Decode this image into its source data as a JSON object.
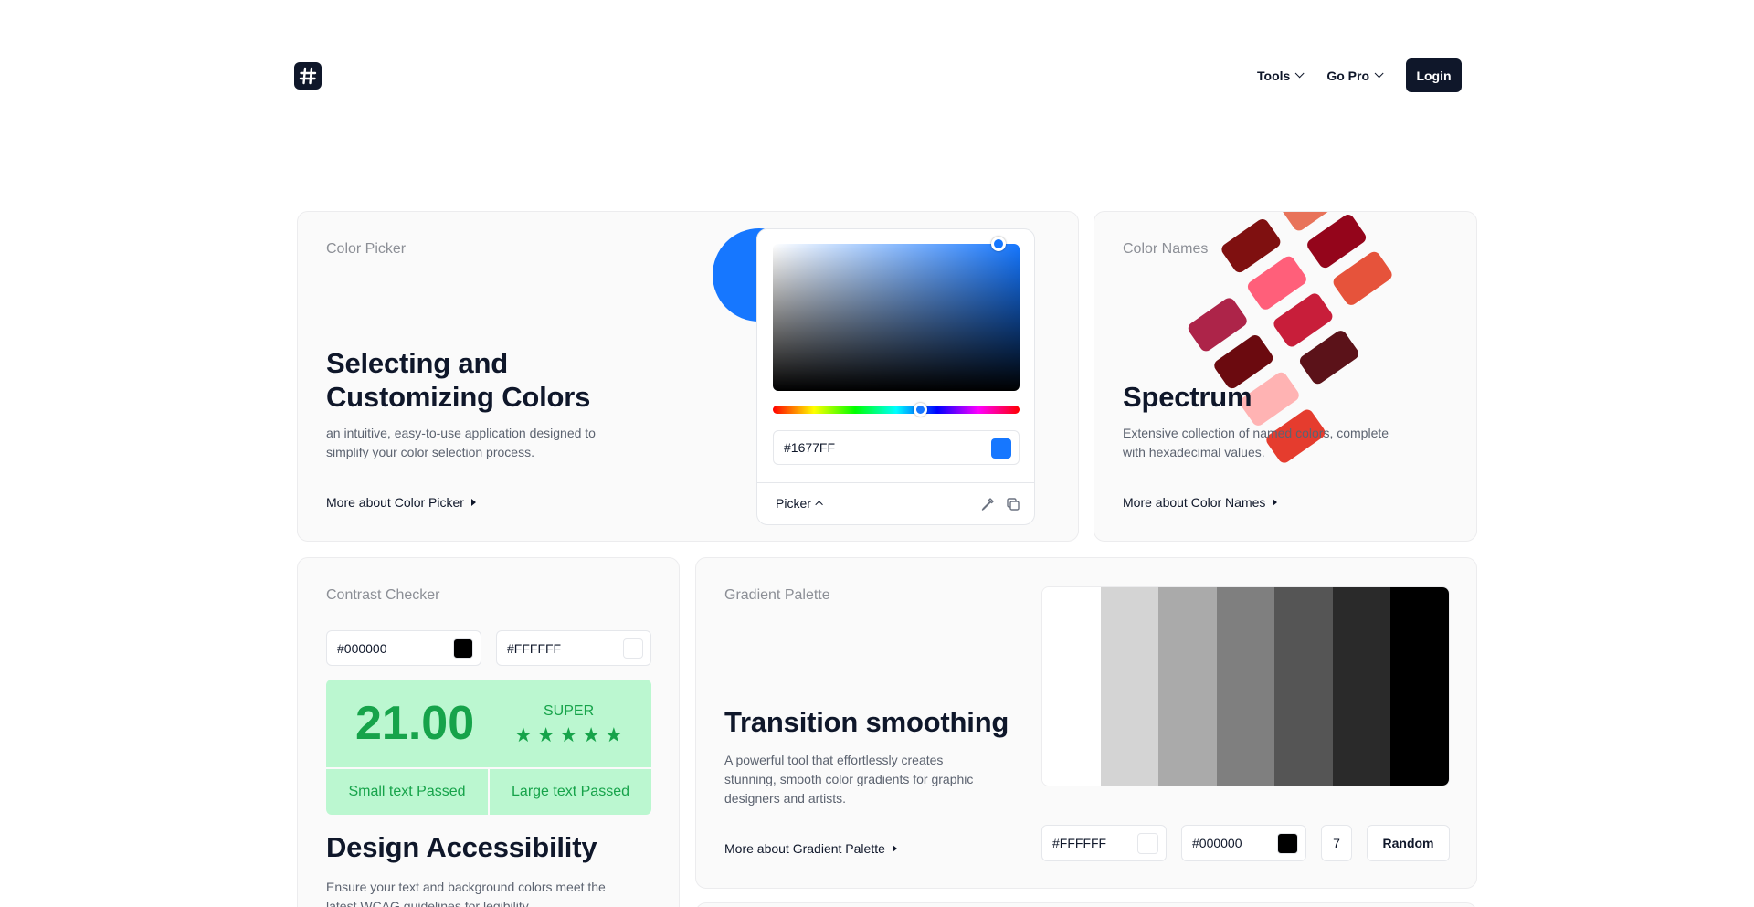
{
  "header": {
    "logo_glyph": "#",
    "nav": [
      {
        "label": "Tools"
      },
      {
        "label": "Go Pro"
      }
    ],
    "login_label": "Login"
  },
  "color_picker_card": {
    "label": "Color Picker",
    "title_line1": "Selecting and",
    "title_line2": "Customizing Colors",
    "desc_line1": "an intuitive, easy-to-use application designed to",
    "desc_line2": "simplify your color selection process.",
    "link": "More about Color Picker",
    "widget": {
      "hex_value": "#1677FF",
      "swatch_color": "#1677FF",
      "mode_label": "Picker",
      "hue_position_percent": 60,
      "icons": [
        "eyedropper-icon",
        "copy-icon"
      ]
    }
  },
  "color_names_card": {
    "label": "Color Names",
    "title": "Spectrum",
    "desc_line1": "Extensive collection of named colors, complete",
    "desc_line2": "with hexadecimal values.",
    "link": "More about Color Names",
    "tile_colors": [
      "#7f1010",
      "#9b0e2d",
      "#ff3b30",
      "#ad2449",
      "#ff5f7a",
      "#94051b",
      "#6b0a0f",
      "#c81e3a",
      "#e6533b",
      "#ffb3b3",
      "#5b1219",
      "#e53c2e",
      "#f27a6a",
      "#f52a4e"
    ]
  },
  "contrast_card": {
    "label": "Contrast Checker",
    "foreground": "#000000",
    "background": "#FFFFFF",
    "ratio": "21.00",
    "grade": "SUPER",
    "stars": 5,
    "small_text": "Small text Passed",
    "large_text": "Large text Passed",
    "title": "Design Accessibility",
    "desc_line1": "Ensure your text and background colors meet the",
    "desc_line2": "latest WCAG guidelines for legibility.",
    "colors": {
      "pass_bg": "#bbf7d0",
      "pass_text": "#16a34a"
    }
  },
  "gradient_card": {
    "label": "Gradient Palette",
    "title": "Transition smoothing",
    "desc_line1": "A powerful tool that effortlessly creates",
    "desc_line2": "stunning, smooth color gradients for graphic",
    "desc_line3": "designers and artists.",
    "link": "More about Gradient Palette",
    "start_color": "#FFFFFF",
    "end_color": "#000000",
    "steps": "7",
    "random_label": "Random",
    "swatches": [
      "#ffffff",
      "#d4d4d4",
      "#aaaaaa",
      "#7f7f7f",
      "#555555",
      "#2a2a2a",
      "#000000"
    ]
  }
}
